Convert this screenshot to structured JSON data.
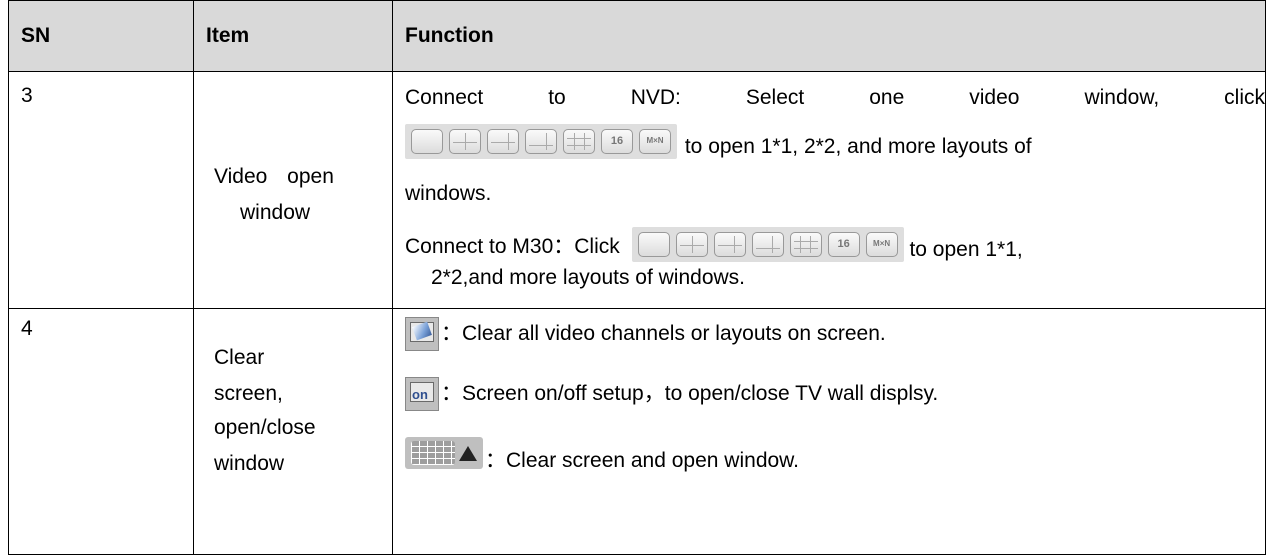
{
  "header": {
    "sn": "SN",
    "item": "Item",
    "function": "Function"
  },
  "row3": {
    "sn": "3",
    "item_line1": "Video open",
    "item_line2": "window",
    "nvd_words": [
      "Connect",
      "to",
      "NVD:",
      "Select",
      "one",
      "video",
      "window,",
      "click"
    ],
    "nvd_rest": "to open 1*1, 2*2, and more layouts of",
    "nvd_end": "windows.",
    "m30_start": "Connect to M30：Click",
    "m30_rest": "to open 1*1,",
    "m30_end": "2*2,and more layouts of windows.",
    "layout_icons": [
      "1x1-layout-icon",
      "2x2-layout-icon",
      "3-split-layout-icon",
      "4-split-layout-icon",
      "3x3-layout-icon",
      "16-layout-icon",
      "mxn-layout-icon"
    ],
    "layout_icon_labels": {
      "sixteen": "16",
      "mxn": "M×N"
    }
  },
  "row4": {
    "sn": "4",
    "item_lines": [
      "Clear",
      "screen,",
      "open/close",
      "window"
    ],
    "clear_all": "：Clear all video channels or layouts on screen.",
    "screen_onoff": "：Screen on/off setup，to open/close TV wall displsy.",
    "on_icon_text": "on",
    "clear_open": "：Clear screen and open window."
  }
}
